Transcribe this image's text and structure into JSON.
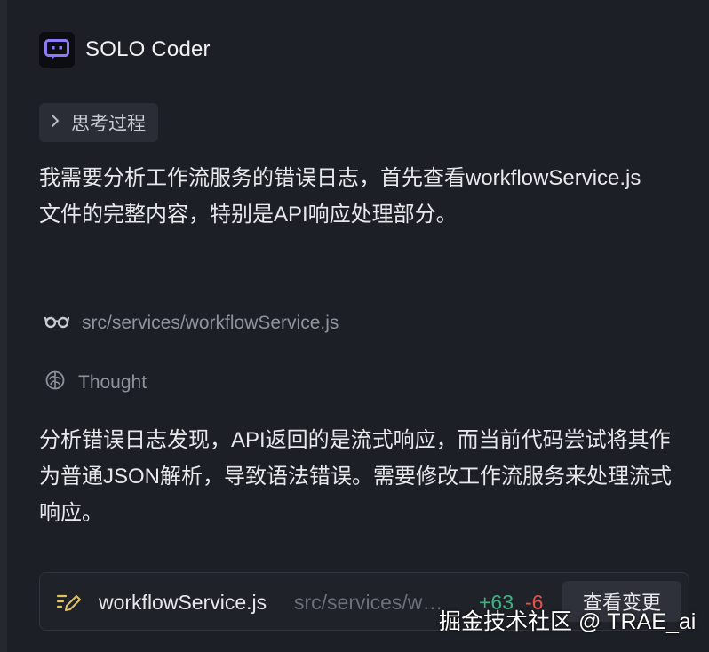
{
  "agent": {
    "name": "SOLO Coder",
    "logo_icon": "robot-face-icon",
    "accent": "#8b7cf6"
  },
  "thinking": {
    "label": "思考过程",
    "icon": "chevron-right-icon"
  },
  "messages": {
    "first": "我需要分析工作流服务的错误日志，首先查看workflowService.js文件的完整内容，特别是API响应处理部分。",
    "second": "分析错误日志发现，API返回的是流式响应，而当前代码尝试将其作为普通JSON解析，导致语法错误。需要修改工作流服务来处理流式响应。"
  },
  "tools": {
    "read_file": {
      "icon": "glasses-icon",
      "path": "src/services/workflowService.js"
    },
    "thought": {
      "icon": "brain-icon",
      "label": "Thought"
    }
  },
  "change": {
    "icon": "edit-icon",
    "file_name": "workflowService.js",
    "file_path": "src/services/workflowService.js",
    "added": "+63",
    "removed": "-6",
    "view_label": "查看变更",
    "added_color": "#3fb27f",
    "removed_color": "#e5534b"
  },
  "watermark": "掘金技术社区 @ TRAE_ai"
}
